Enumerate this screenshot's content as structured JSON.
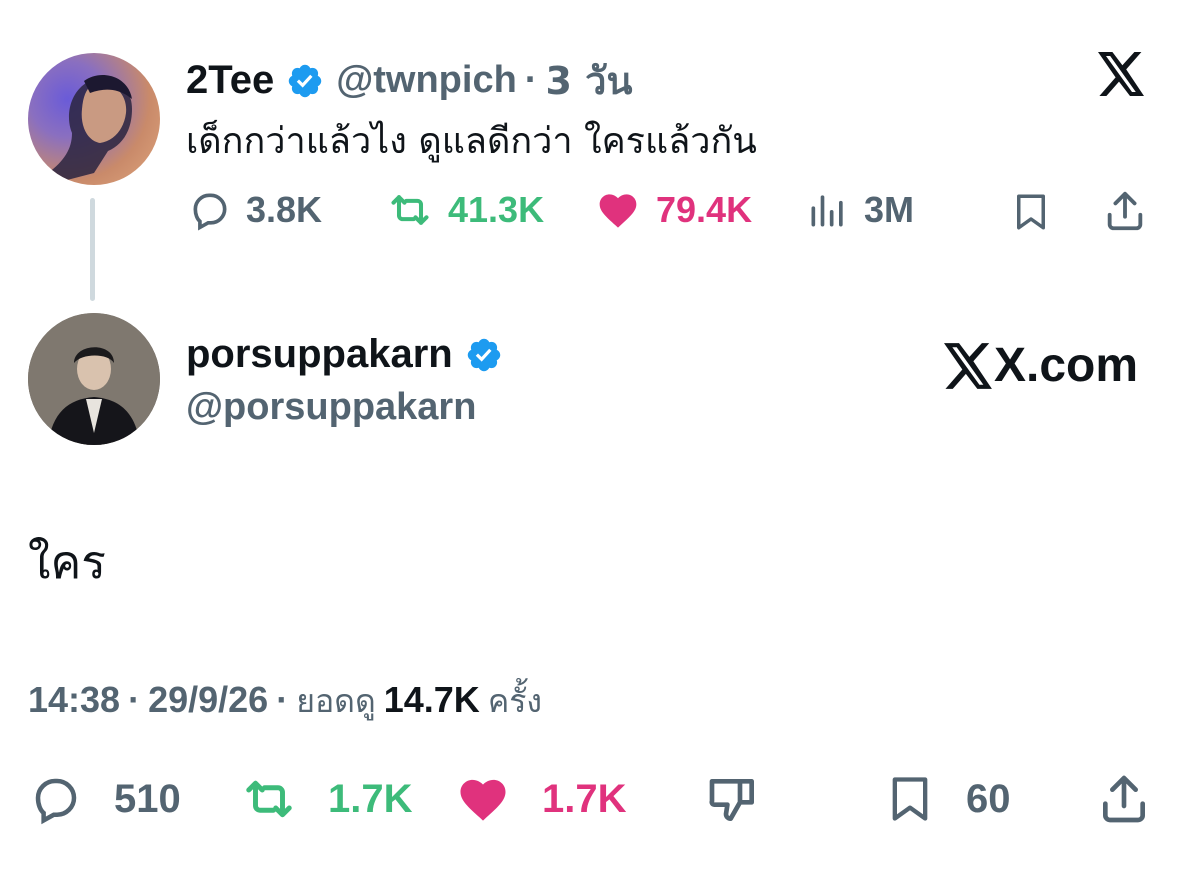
{
  "quoted": {
    "display_name": "2Tee",
    "handle": "@twnpich",
    "dot": "·",
    "age": "3 วัน",
    "text": "เด็กกว่าแล้วไง ดูแลดีกว่า ใครแล้วกัน",
    "stats": {
      "replies": "3.8K",
      "reposts": "41.3K",
      "likes": "79.4K",
      "views": "3M"
    }
  },
  "main": {
    "display_name": "porsuppakarn",
    "handle": "@porsuppakarn",
    "brand": "X.com",
    "text": "ใคร",
    "meta": {
      "time": "14:38",
      "sep1": "·",
      "date": "29/9/26",
      "sep2": "·",
      "views_label": "ยอดดู",
      "views_value": "14.7K",
      "views_suffix": "ครั้ง"
    },
    "stats": {
      "replies": "510",
      "reposts": "1.7K",
      "likes": "1.7K",
      "bookmarks": "60"
    }
  },
  "colors": {
    "verified": "#1d9bf0",
    "repost": "#3dbb7a",
    "like": "#e0327d",
    "muted": "#536471"
  }
}
